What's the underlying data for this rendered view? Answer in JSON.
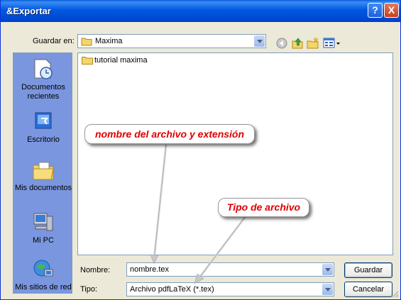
{
  "window": {
    "title": "&Exportar",
    "help_label": "?",
    "close_label": "X"
  },
  "toolbar": {
    "save_in_label": "Guardar en:",
    "folder_value": "Maxima",
    "icons": [
      "back-icon",
      "up-folder-icon",
      "new-folder-icon",
      "views-menu-icon"
    ]
  },
  "places": [
    {
      "label": "Documentos recientes",
      "icon": "recent-documents-icon"
    },
    {
      "label": "Escritorio",
      "icon": "desktop-icon"
    },
    {
      "label": "Mis documentos",
      "icon": "my-documents-icon"
    },
    {
      "label": "Mi PC",
      "icon": "my-computer-icon"
    },
    {
      "label": "Mis sitios de red",
      "icon": "network-places-icon"
    }
  ],
  "files": [
    {
      "name": "tutorial maxima",
      "icon": "folder-icon"
    }
  ],
  "form": {
    "name_label": "Nombre:",
    "name_value": "nombre.tex",
    "type_label": "Tipo:",
    "type_value": "Archivo pdfLaTeX (*.tex)"
  },
  "buttons": {
    "save": "Guardar",
    "cancel": "Cancelar"
  },
  "annotations": {
    "filename_callout": "nombre del archivo y extensión",
    "filetype_callout": "Tipo de archivo"
  },
  "colors": {
    "titlebar": "#0054E3",
    "places_bar": "#7A96DF",
    "callout_text": "#E00000"
  }
}
